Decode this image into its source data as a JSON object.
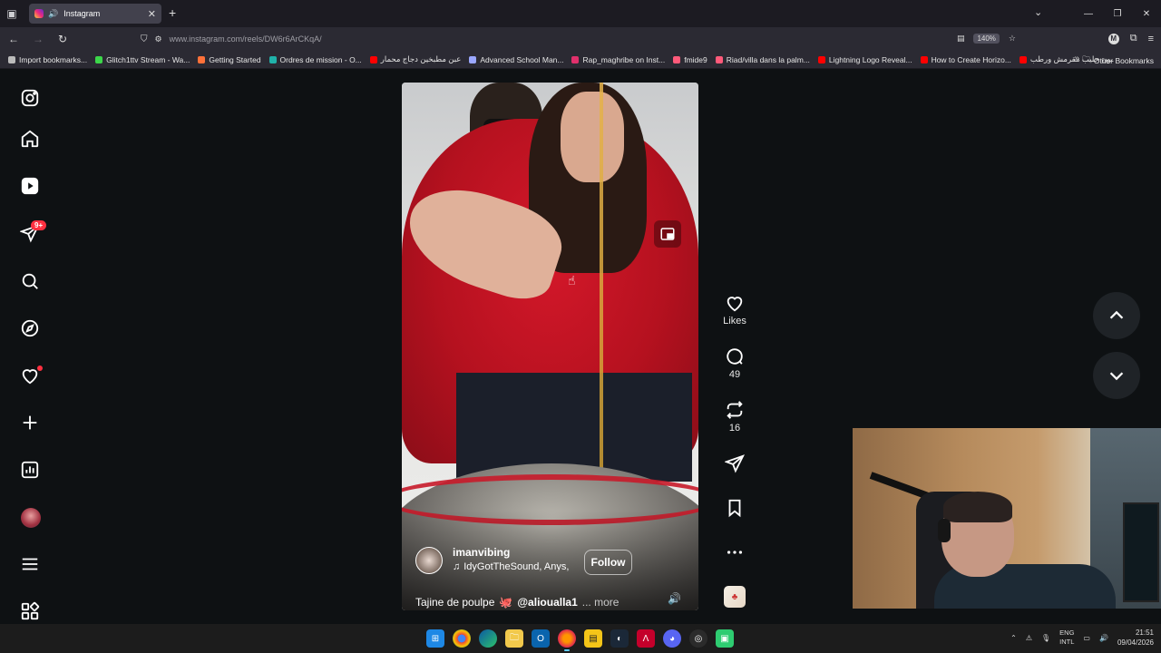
{
  "browser": {
    "tab_title": "Instagram",
    "url": "www.instagram.com/reels/DW6r6ArCKqA/",
    "zoom": "140%",
    "profile_initial": "M",
    "bookmarks": [
      {
        "label": "Import bookmarks...",
        "color": "#bbbbbb"
      },
      {
        "label": "Glitch1ttv Stream - Wa...",
        "color": "#3cd64a"
      },
      {
        "label": "Getting Started",
        "color": "#ff7139"
      },
      {
        "label": "Ordres de mission - O...",
        "color": "#20b2aa"
      },
      {
        "label": "عبن مطبخين دجاج محمار",
        "color": "#ff0000"
      },
      {
        "label": "Advanced School Man...",
        "color": "#9aa7ff"
      },
      {
        "label": "Rap_maghribe on Inst...",
        "color": "#e1306c"
      },
      {
        "label": "fmide9",
        "color": "#ff5a7a"
      },
      {
        "label": "Riad/villa dans la palm...",
        "color": "#ff5a7a"
      },
      {
        "label": "Lightning Logo Reveal...",
        "color": "#ff0000"
      },
      {
        "label": "How to Create Horizo...",
        "color": "#ff0000"
      },
      {
        "label": "ـون حليب مقرمش ورطب",
        "color": "#ff0000"
      }
    ],
    "other_bookmarks": "Other Bookmarks"
  },
  "sidebar": {
    "notification_badge": "9+"
  },
  "reel": {
    "author": "imanvibing",
    "audio": "IdyGotTheSound, Anys,",
    "follow_label": "Follow",
    "caption_text": "Tajine de poulpe",
    "caption_mention": "@alioualla1",
    "caption_more": "... more",
    "actions": {
      "likes_label": "Likes",
      "comments_count": "49",
      "reposts_count": "16"
    }
  },
  "taskbar": {
    "lang_top": "ENG",
    "lang_bottom": "INTL",
    "time": "21:51",
    "date": "09/04/2026"
  }
}
